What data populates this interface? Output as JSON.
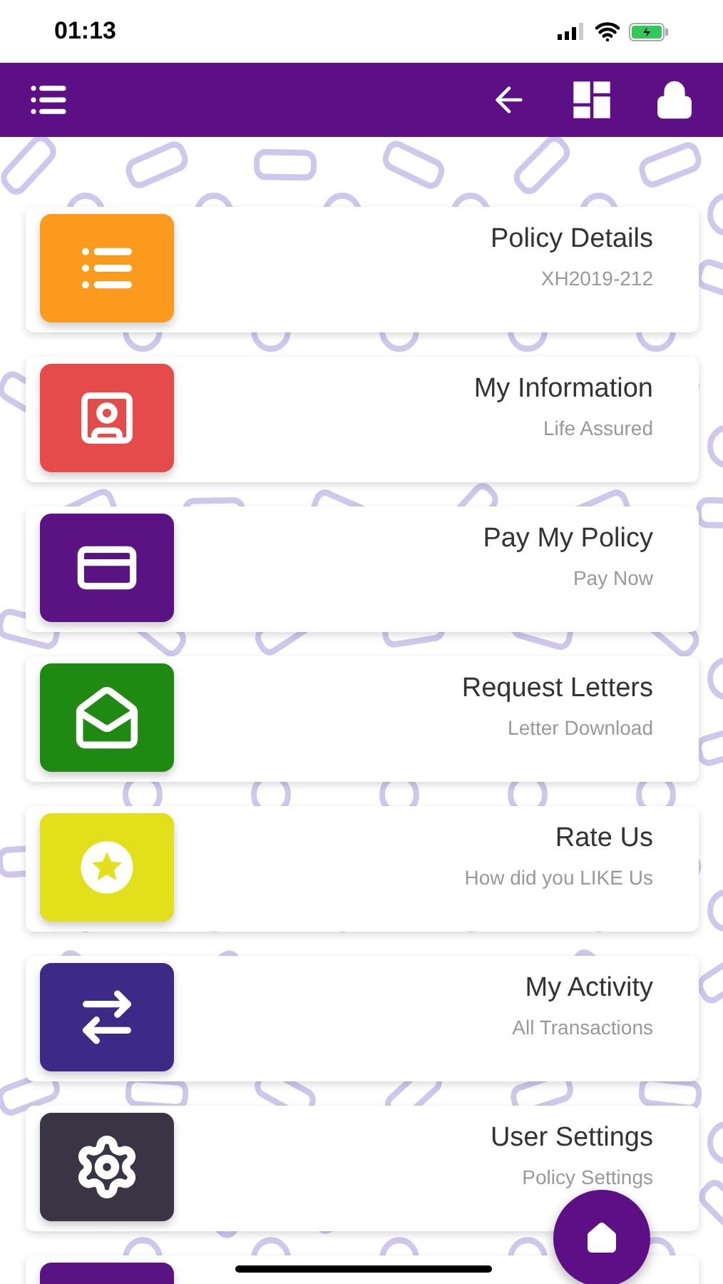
{
  "status_bar": {
    "time": "01:13"
  },
  "items": [
    {
      "title": "Policy Details",
      "subtitle": "XH2019-212",
      "color": "#fb9a1c"
    },
    {
      "title": "My Information",
      "subtitle": "Life Assured",
      "color": "#e64b4b"
    },
    {
      "title": "Pay My Policy",
      "subtitle": "Pay Now",
      "color": "#5b1384"
    },
    {
      "title": "Request Letters",
      "subtitle": "Letter Download",
      "color": "#1f8a12"
    },
    {
      "title": "Rate Us",
      "subtitle": "How did you LIKE Us",
      "color": "#e2e01a"
    },
    {
      "title": "My Activity",
      "subtitle": "All Transactions",
      "color": "#3d2a86"
    },
    {
      "title": "User Settings",
      "subtitle": "Policy Settings",
      "color": "#3a3445"
    },
    {
      "color": "#5b1384"
    }
  ]
}
